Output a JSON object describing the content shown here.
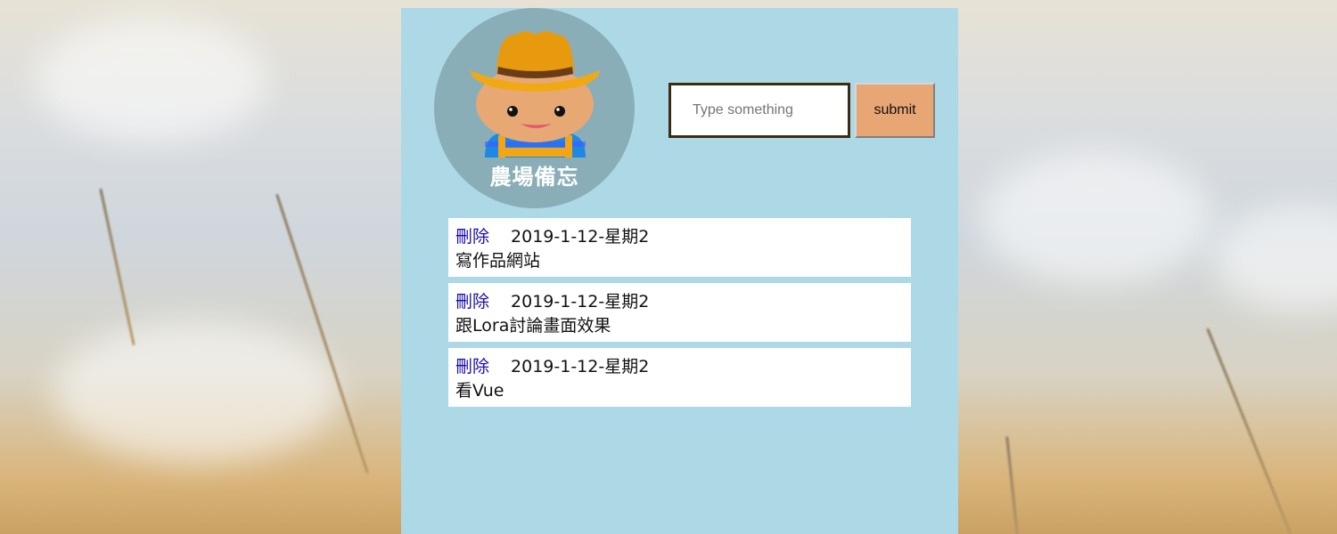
{
  "logo": {
    "title": "農場備忘",
    "icon": "farmer-icon"
  },
  "form": {
    "placeholder": "Type something",
    "value": "",
    "submit_label": "submit"
  },
  "notes": [
    {
      "delete_label": "刪除",
      "date": "2019-1-12-星期2",
      "text": "寫作品網站"
    },
    {
      "delete_label": "刪除",
      "date": "2019-1-12-星期2",
      "text": "跟Lora討論畫面效果"
    },
    {
      "delete_label": "刪除",
      "date": "2019-1-12-星期2",
      "text": "看Vue"
    }
  ],
  "colors": {
    "panel": "#add8e6",
    "button": "#e8a674",
    "logo_circle": "#8aaeb8",
    "link": "#1a0dab"
  }
}
